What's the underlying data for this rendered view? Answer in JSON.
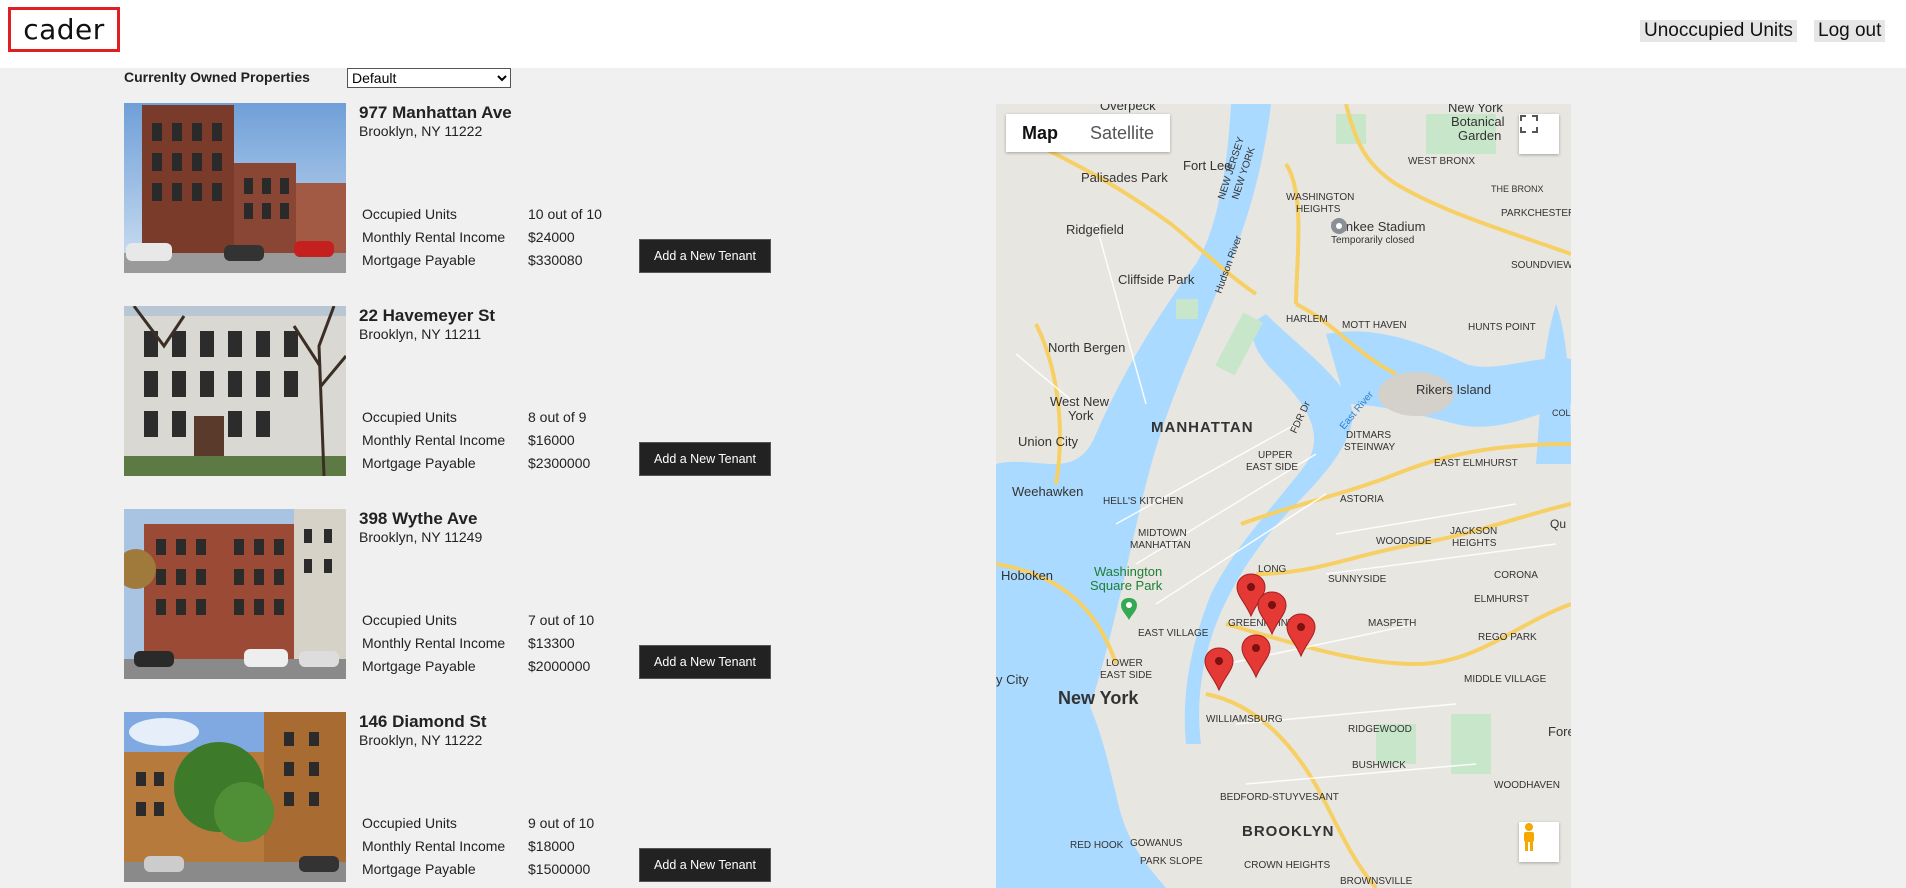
{
  "header": {
    "logo": "cader",
    "nav": {
      "unoccupied": "Unoccupied Units",
      "logout": "Log out"
    }
  },
  "toolbar": {
    "owned_label": "Currenlty Owned Properties",
    "sort_selected": "Default"
  },
  "stat_labels": {
    "occupied": "Occupied Units",
    "income": "Monthly Rental Income",
    "mortgage": "Mortgage Payable"
  },
  "add_tenant_label": "Add a New Tenant",
  "properties": [
    {
      "address": "977 Manhattan Ave",
      "city": "Brooklyn, NY 11222",
      "occupied": "10 out of 10",
      "income": "$24000",
      "mortgage": "$330080"
    },
    {
      "address": "22 Havemeyer St",
      "city": "Brooklyn, NY 11211",
      "occupied": "8 out of 9",
      "income": "$16000",
      "mortgage": "$2300000"
    },
    {
      "address": "398 Wythe Ave",
      "city": "Brooklyn, NY 11249",
      "occupied": "7 out of 10",
      "income": "$13300",
      "mortgage": "$2000000"
    },
    {
      "address": "146 Diamond St",
      "city": "Brooklyn, NY 11222",
      "occupied": "9 out of 10",
      "income": "$18000",
      "mortgage": "$1500000"
    }
  ],
  "map": {
    "toggle_map": "Map",
    "toggle_satellite": "Satellite",
    "labels": {
      "overpeck": "Overpeck",
      "ny_botanical": "New York",
      "ny_botanical2": "Botanical",
      "ny_botanical3": "Garden",
      "new_jersey": "NEW JERSEY",
      "new_york_state": "NEW YORK",
      "west_bronx": "WEST BRONX",
      "the_bronx": "THE BRONX",
      "fort_lee": "Fort Lee",
      "palisades_park": "Palisades Park",
      "washington_heights": "WASHINGTON",
      "washington_heights2": "HEIGHTS",
      "parkchester": "PARKCHESTER",
      "yankee_stadium": "Yankee Stadium",
      "temp_closed": "Temporarily closed",
      "ridgefield": "Ridgefield",
      "soundview": "SOUNDVIEW",
      "cliffside_park": "Cliffside Park",
      "hudson_river": "Hudson River",
      "harlem": "HARLEM",
      "mott_haven": "MOTT HAVEN",
      "hunts_point": "HUNTS POINT",
      "north_bergen": "North Bergen",
      "rikers_island": "Rikers Island",
      "west_new_york": "West New",
      "west_new_york2": "York",
      "manhattan": "MANHATTAN",
      "ditmars": "DITMARS",
      "steinway": "STEINWAY",
      "union_city": "Union City",
      "upper_east_side": "UPPER",
      "upper_east_side2": "EAST SIDE",
      "east_elmhurst": "EAST ELMHURST",
      "weehawken": "Weehawken",
      "hells_kitchen": "HELL'S KITCHEN",
      "astoria": "ASTORIA",
      "midtown": "MIDTOWN",
      "midtown2": "MANHATTAN",
      "woodside": "WOODSIDE",
      "jackson_heights": "JACKSON",
      "jackson_heights2": "HEIGHTS",
      "hoboken": "Hoboken",
      "washington_sq": "Washington",
      "washington_sq2": "Square Park",
      "long_island_city": "LONG",
      "sunnyside": "SUNNYSIDE",
      "corona": "CORONA",
      "elmhurst": "ELMHURST",
      "greenpoint": "GREENPOINT",
      "maspeth": "MASPETH",
      "rego_park": "REGO PARK",
      "east_village": "EAST VILLAGE",
      "lower_east_side": "LOWER",
      "lower_east_side2": "EAST SIDE",
      "jersey_city": "y City",
      "new_york": "New York",
      "middle_village": "MIDDLE VILLAGE",
      "williamsburg": "WILLIAMSBURG",
      "ridgewood": "RIDGEWOOD",
      "bushwick": "BUSHWICK",
      "woodhaven": "WOODHAVEN",
      "bedford_stuy": "BEDFORD-STUYVESANT",
      "brooklyn": "BROOKLYN",
      "red_hook": "RED HOOK",
      "gowanus": "GOWANUS",
      "park_slope": "PARK SLOPE",
      "crown_heights": "CROWN HEIGHTS",
      "brownsville": "BROWNSVILLE",
      "fdr": "FDR Dr",
      "east_river": "East River",
      "qu": "Qu",
      "forest": "Fores",
      "col": "COL"
    }
  }
}
